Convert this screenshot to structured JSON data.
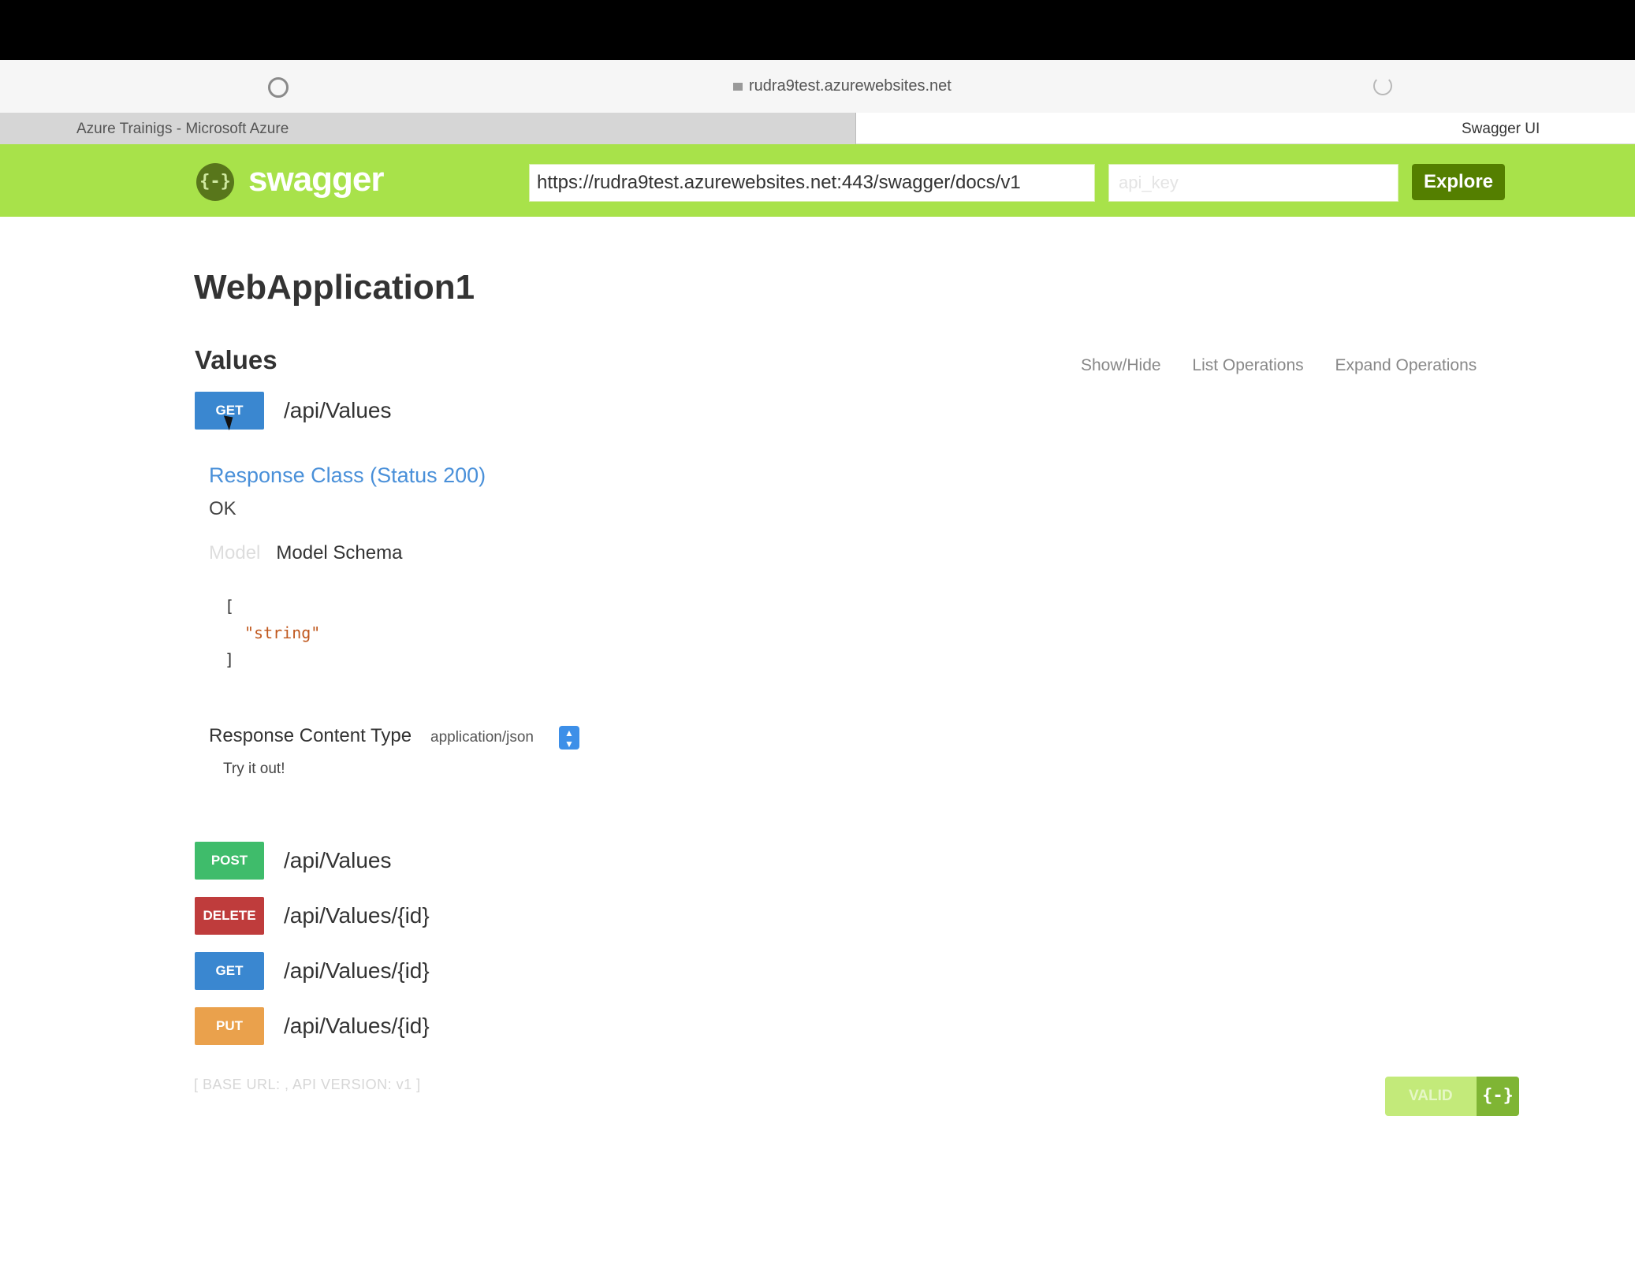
{
  "browser": {
    "address": "rudra9test.azurewebsites.net",
    "tabs": [
      {
        "label": "Azure Trainigs - Microsoft Azure",
        "active": false
      },
      {
        "label": "Swagger UI",
        "active": true
      }
    ]
  },
  "header": {
    "logo_text": "swagger",
    "logo_glyph": "{-}",
    "url_value": "https://rudra9test.azurewebsites.net:443/swagger/docs/v1",
    "api_key_placeholder": "api_key",
    "explore_label": "Explore",
    "color": "#a8e24a"
  },
  "app_title": "WebApplication1",
  "section": {
    "title": "Values",
    "links": [
      "Show/Hide",
      "List Operations",
      "Expand Operations"
    ]
  },
  "expanded_operation": {
    "method": "GET",
    "path": "/api/Values",
    "response_class": "Response Class (Status 200)",
    "response_status_text": "OK",
    "model_tabs": [
      "Model",
      "Model Schema"
    ],
    "schema_open": "[",
    "schema_value": "\"string\"",
    "schema_close": "]",
    "content_type_label": "Response Content Type",
    "content_type_value": "application/json",
    "try_it_label": "Try it out!"
  },
  "operations": [
    {
      "method": "POST",
      "path": "/api/Values",
      "color": "#3fbc6b"
    },
    {
      "method": "DELETE",
      "path": "/api/Values/{id}",
      "color": "#bf3c3c"
    },
    {
      "method": "GET",
      "path": "/api/Values/{id}",
      "color": "#3a87d0"
    },
    {
      "method": "PUT",
      "path": "/api/Values/{id}",
      "color": "#eaa14c"
    }
  ],
  "footer": {
    "info": "[ BASE URL: , API VERSION: v1 ]",
    "valid_label": "VALID",
    "valid_glyph": "{-}"
  }
}
